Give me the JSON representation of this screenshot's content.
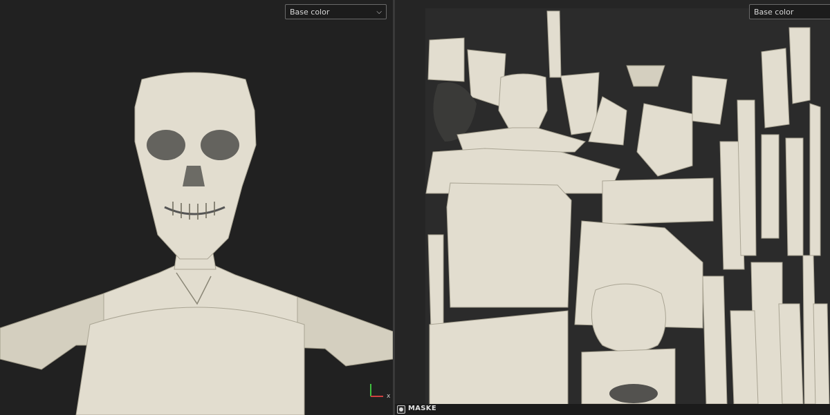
{
  "viewport_3d": {
    "channel_dropdown": {
      "selected": "Base color",
      "icon": "chevron-down-icon"
    },
    "gizmo": {
      "x_label": "x",
      "icon": "axis-gizmo-icon"
    }
  },
  "viewport_2d": {
    "channel_dropdown": {
      "selected": "Base color"
    },
    "mask_toggle": {
      "label": "MASKE",
      "icon": "mask-icon"
    }
  },
  "colors": {
    "bone": "#e2ddcf",
    "background": "#212121",
    "uv_background": "#2b2b2b",
    "axis_x": "#d04040",
    "axis_y": "#40c040"
  }
}
